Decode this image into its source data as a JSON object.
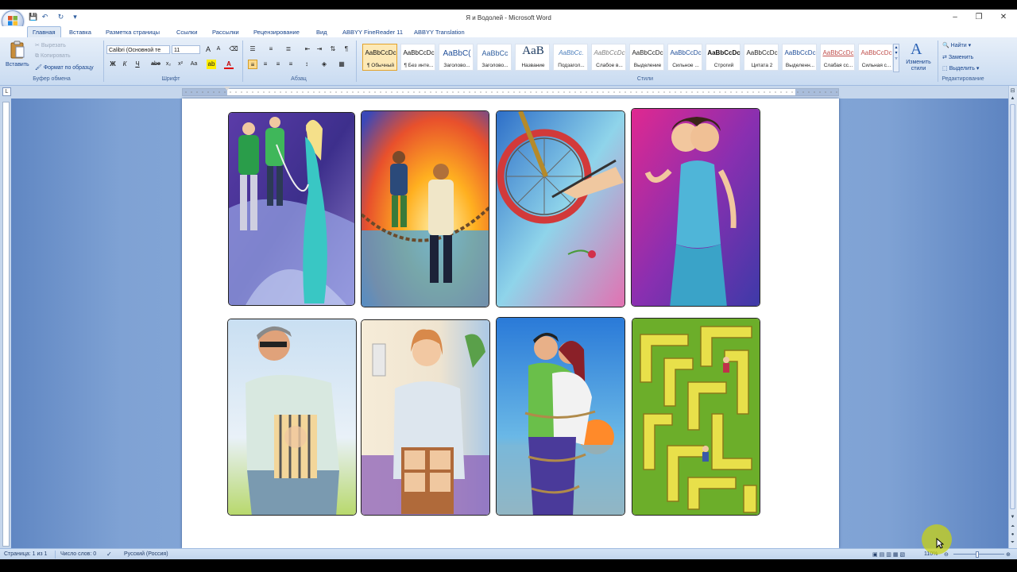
{
  "window": {
    "title": "Я и Водолей - Microsoft Word",
    "controls": {
      "minimize": "–",
      "restore": "❐",
      "close": "✕"
    }
  },
  "quick_access": {
    "save": "💾",
    "undo": "↶",
    "redo": "↻",
    "customize": "▾"
  },
  "tabs": [
    "Главная",
    "Вставка",
    "Разметка страницы",
    "Ссылки",
    "Рассылки",
    "Рецензирование",
    "Вид",
    "ABBYY FineReader 11",
    "ABBYY Translation"
  ],
  "ribbon": {
    "clipboard": {
      "paste_label": "Вставить",
      "cut_label": "Вырезать",
      "copy_label": "Копировать",
      "format_painter_label": "Формат по образцу",
      "group_label": "Буфер обмена"
    },
    "font": {
      "font_name": "Calibri (Основной те",
      "font_size": "11",
      "bold": "Ж",
      "italic": "К",
      "underline": "Ч",
      "strike": "abe",
      "subscript": "x₂",
      "superscript": "x²",
      "case": "Aa",
      "grow": "A",
      "shrink": "A",
      "group_label": "Шрифт"
    },
    "paragraph": {
      "group_label": "Абзац"
    },
    "styles": {
      "group_label": "Стили",
      "items": [
        {
          "preview": "AaBbCcDc",
          "name": "¶ Обычный"
        },
        {
          "preview": "AaBbCcDc",
          "name": "¶ Без инте..."
        },
        {
          "preview": "AaBbC(",
          "name": "Заголово..."
        },
        {
          "preview": "AaBbCc",
          "name": "Заголово..."
        },
        {
          "preview": "AaB",
          "name": "Название"
        },
        {
          "preview": "AaBbCc.",
          "name": "Подзагол..."
        },
        {
          "preview": "AaBbCcDc",
          "name": "Слабое в..."
        },
        {
          "preview": "AaBbCcDc",
          "name": "Выделение"
        },
        {
          "preview": "AaBbCcDc",
          "name": "Сильное ..."
        },
        {
          "preview": "AaBbCcDc",
          "name": "Строгий"
        },
        {
          "preview": "AaBbCcDc",
          "name": "Цитата 2"
        },
        {
          "preview": "AaBbCcDc",
          "name": "Выделенн..."
        },
        {
          "preview": "AaBbCcDc",
          "name": "Слабая сс..."
        },
        {
          "preview": "AaBbCcDc",
          "name": "Сильная с..."
        }
      ],
      "change_styles_label": "Изменить стили"
    },
    "editing": {
      "find_label": "Найти",
      "replace_label": "Заменить",
      "select_label": "Выделить",
      "group_label": "Редактирование"
    }
  },
  "status": {
    "page": "Страница: 1 из 1",
    "words": "Число слов: 0",
    "language": "Русский (Россия)",
    "zoom": "110%"
  },
  "colors": {
    "ribbon_top": "#e7eff9",
    "workspace": "#8fb0de",
    "accent": "#15428b"
  }
}
